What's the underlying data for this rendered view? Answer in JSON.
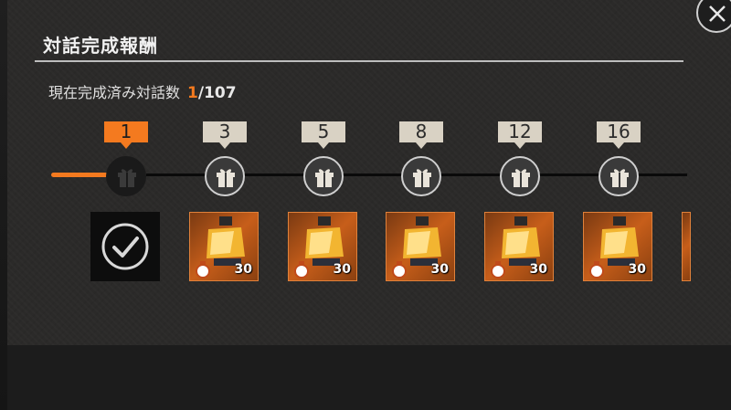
{
  "title": "対話完成報酬",
  "progress": {
    "label": "現在完成済み対話数",
    "current": "1",
    "total": "/107"
  },
  "milestones": [
    {
      "label": "1",
      "status": "claimed"
    },
    {
      "label": "3",
      "status": "pending"
    },
    {
      "label": "5",
      "status": "pending"
    },
    {
      "label": "8",
      "status": "pending"
    },
    {
      "label": "12",
      "status": "pending"
    },
    {
      "label": "16",
      "status": "pending"
    }
  ],
  "rewards": [
    {
      "icon": "lantern-item-icon",
      "quantity": "30"
    },
    {
      "icon": "lantern-item-icon",
      "quantity": "30"
    },
    {
      "icon": "lantern-item-icon",
      "quantity": "30"
    },
    {
      "icon": "lantern-item-icon",
      "quantity": "30"
    },
    {
      "icon": "lantern-item-icon",
      "quantity": "30"
    }
  ],
  "colors": {
    "accent": "#f47a1f",
    "label_bg": "#d9d2c4",
    "panel": "#2b2a29"
  }
}
